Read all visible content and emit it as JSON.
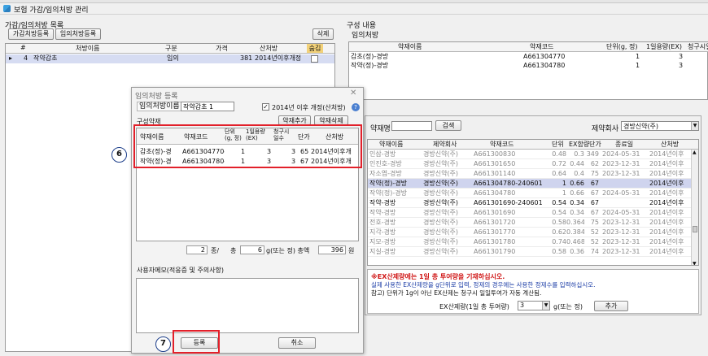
{
  "window": {
    "title": "보험 가감/임의처방 관리"
  },
  "left_panel": {
    "title": "가감/임의처방 목록",
    "buttons": {
      "add_adjust": "가감처방등록",
      "add_custom": "임의처방등록",
      "delete": "삭제"
    },
    "columns": [
      "#",
      "처방이름",
      "구분",
      "가격",
      "산처방",
      "숨김"
    ],
    "rows": [
      {
        "num": "4",
        "name": "작약감초",
        "type": "임의",
        "price": "381",
        "sanchubang": "2014년이후개정"
      }
    ]
  },
  "right_panel": {
    "title": "구성 내용",
    "subtitle": "임의처방",
    "columns": [
      "약재이름",
      "약재코드",
      "단위(g, 정)",
      "1일용량(EX)",
      "청구시일"
    ],
    "rows": [
      {
        "name": "감초(정)-경방",
        "code": "A661304770",
        "unit": "1",
        "dose": "3"
      },
      {
        "name": "작약(정)-경방",
        "code": "A661304780",
        "unit": "1",
        "dose": "3"
      }
    ]
  },
  "dialog": {
    "title": "임의처방 등록",
    "name_label": "임의처방이름",
    "name_value": "작약감초 1",
    "revision_label": "2014년 이후 개정(산처방)",
    "composition_label": "구성약재",
    "add_herb": "약재추가",
    "delete_herb": "약재삭제",
    "columns": [
      "약재이름",
      "약재코드",
      "단위 (g, 정)",
      "1일용량 (EX)",
      "청구시 일수",
      "단가",
      "산처방"
    ],
    "rows": [
      {
        "name": "감초(정)-경",
        "code": "A661304770-24",
        "unit": "1",
        "dose": "3",
        "days": "3",
        "price": "65",
        "sanchubang": "2014년이후개"
      },
      {
        "name": "작약(정)-경",
        "code": "A661304780-24",
        "unit": "1",
        "dose": "3",
        "days": "3",
        "price": "67",
        "sanchubang": "2014년이후개"
      }
    ],
    "summary": {
      "count": "2",
      "count_unit": "종/",
      "total_label": "총",
      "total_g": "6",
      "g_label": "g(또는 정) 총액",
      "amount": "396",
      "won": "원"
    },
    "memo_label": "사용자메모(적응증 및 주의사항)",
    "register": "등록",
    "cancel": "취소"
  },
  "search_panel": {
    "search_label": "약재명",
    "search_value": "",
    "search_button": "검색",
    "maker_label": "제약회사",
    "maker_value": "경방신약(주)",
    "columns": [
      "약재이름",
      "제약회사",
      "약재코드",
      "단위",
      "EX함량",
      "단가",
      "종료일",
      "산처방"
    ],
    "rows": [
      {
        "name": "인삼-경방",
        "maker": "경방신약(주)",
        "code": "A661300830",
        "unit": "0.48",
        "ex": "0.3",
        "price": "349",
        "end": "2024-05-31",
        "san": "2014년이후",
        "dim": true
      },
      {
        "name": "인진호-경방",
        "maker": "경방신약(주)",
        "code": "A661301650",
        "unit": "0.72",
        "ex": "0.44",
        "price": "62",
        "end": "2023-12-31",
        "san": "2014년이후",
        "dim": true
      },
      {
        "name": "자소엽-경방",
        "maker": "경방신약(주)",
        "code": "A661301140",
        "unit": "0.64",
        "ex": "0.4",
        "price": "75",
        "end": "2023-12-31",
        "san": "2014년이후",
        "dim": true
      },
      {
        "name": "작약(정)-경방",
        "maker": "경방신약(주)",
        "code": "A661304780-240601",
        "unit": "1",
        "ex": "0.66",
        "price": "67",
        "end": "",
        "san": "2014년이후",
        "dim": false,
        "selected": true
      },
      {
        "name": "작약(정)-경방",
        "maker": "경방신약(주)",
        "code": "A661304780",
        "unit": "1",
        "ex": "0.66",
        "price": "67",
        "end": "2024-05-31",
        "san": "2014년이후",
        "dim": true
      },
      {
        "name": "작약-경방",
        "maker": "경방신약(주)",
        "code": "A661301690-240601",
        "unit": "0.54",
        "ex": "0.34",
        "price": "67",
        "end": "",
        "san": "2014년이후",
        "dim": false
      },
      {
        "name": "작약-경방",
        "maker": "경방신약(주)",
        "code": "A661301690",
        "unit": "0.54",
        "ex": "0.34",
        "price": "67",
        "end": "2024-05-31",
        "san": "2014년이후",
        "dim": true
      },
      {
        "name": "전호-경방",
        "maker": "경방신약(주)",
        "code": "A661301720",
        "unit": "0.58",
        "ex": "0.364",
        "price": "75",
        "end": "2023-12-31",
        "san": "2014년이후",
        "dim": true
      },
      {
        "name": "지각-경방",
        "maker": "경방신약(주)",
        "code": "A661301770",
        "unit": "0.62",
        "ex": "0.384",
        "price": "52",
        "end": "2023-12-31",
        "san": "2014년이후",
        "dim": true
      },
      {
        "name": "지모-경방",
        "maker": "경방신약(주)",
        "code": "A661301780",
        "unit": "0.74",
        "ex": "0.468",
        "price": "52",
        "end": "2023-12-31",
        "san": "2014년이후",
        "dim": true
      },
      {
        "name": "지실-경방",
        "maker": "경방신약(주)",
        "code": "A661301790",
        "unit": "0.58",
        "ex": "0.36",
        "price": "74",
        "end": "2023-12-31",
        "san": "2014년이후",
        "dim": true
      }
    ],
    "notice_red": "※EX산제량에는 1일 총 투여량을 기재하십시오.",
    "notice_blue_1": "실제 사용한 EX산제량을 g단위로 입력, 정제의 경우에는 사용한 정제수를 입력하십시오.",
    "notice_black_2": "참고) 단위가 1g이 아닌 EX산제는 청구시 일일투여가 자동 계산됨.",
    "ex_label": "EX산제량(1일 총 투여량)",
    "ex_value": "3",
    "ex_unit": "g(또는 정)",
    "add_button": "추가"
  },
  "callouts": {
    "six": "6",
    "seven": "7"
  },
  "colors": {
    "accent_red": "#e2202a",
    "selected_row": "#cfd4ee",
    "dim_text": "#8a8a8a"
  }
}
